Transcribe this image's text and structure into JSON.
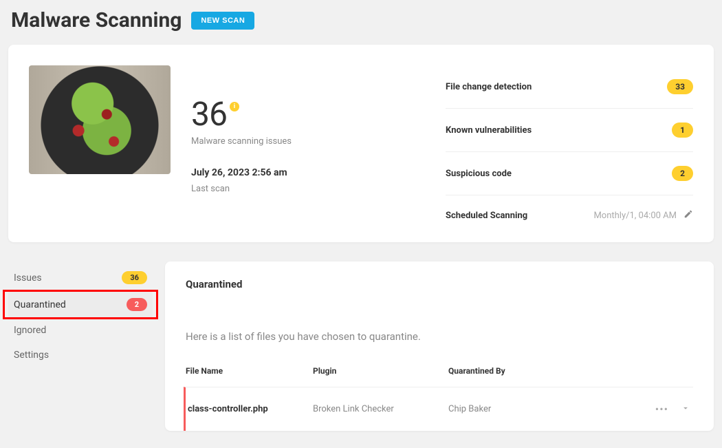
{
  "header": {
    "title": "Malware Scanning",
    "new_scan_btn": "NEW SCAN"
  },
  "summary": {
    "issue_count": "36",
    "issue_label": "Malware scanning issues",
    "last_scan_time": "July 26, 2023 2:56 am",
    "last_scan_label": "Last scan",
    "stats": [
      {
        "label": "File change detection",
        "count": "33"
      },
      {
        "label": "Known vulnerabilities",
        "count": "1"
      },
      {
        "label": "Suspicious code",
        "count": "2"
      }
    ],
    "schedule_label": "Scheduled Scanning",
    "schedule_value": "Monthly/1, 04:00 AM"
  },
  "sidebar": {
    "items": {
      "issues": {
        "label": "Issues",
        "count": "36"
      },
      "quarantined": {
        "label": "Quarantined",
        "count": "2"
      },
      "ignored": {
        "label": "Ignored"
      },
      "settings": {
        "label": "Settings"
      }
    }
  },
  "panel": {
    "title": "Quarantined",
    "description": "Here is a list of files you have chosen to quarantine.",
    "columns": {
      "file": "File Name",
      "plugin": "Plugin",
      "by": "Quarantined By"
    },
    "rows": [
      {
        "file": "class-controller.php",
        "plugin": "Broken Link Checker",
        "by": "Chip Baker"
      }
    ]
  }
}
